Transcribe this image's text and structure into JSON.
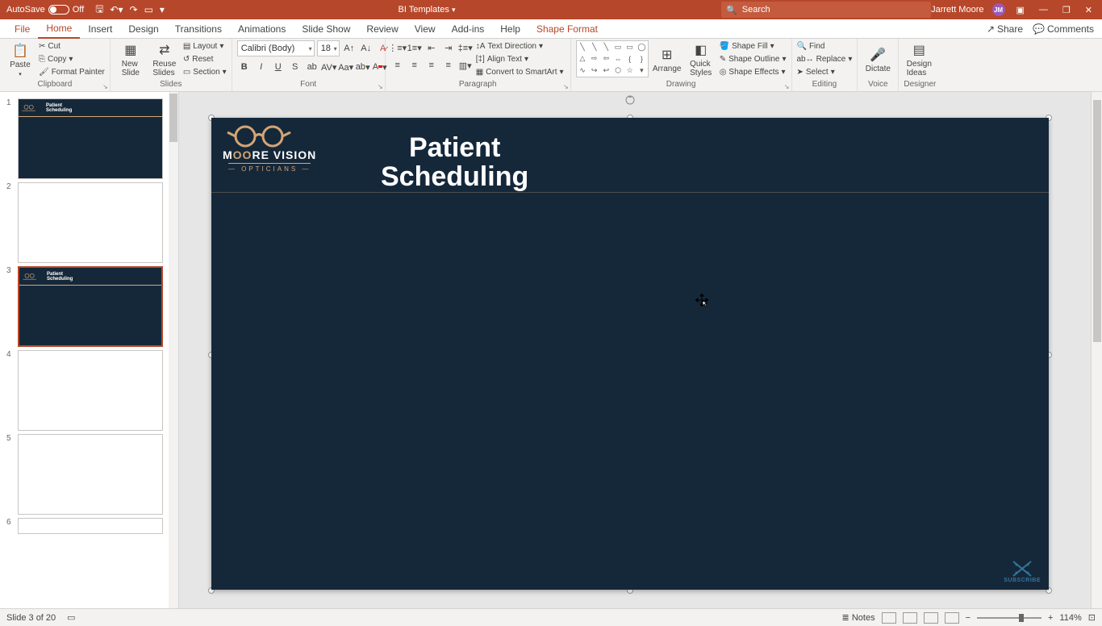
{
  "titlebar": {
    "autosave_label": "AutoSave",
    "autosave_state": "Off",
    "doc_title": "BI Templates",
    "search_placeholder": "Search",
    "user_name": "Jarrett Moore",
    "user_initials": "JM"
  },
  "tabs": {
    "file": "File",
    "home": "Home",
    "insert": "Insert",
    "design": "Design",
    "transitions": "Transitions",
    "animations": "Animations",
    "slideshow": "Slide Show",
    "review": "Review",
    "view": "View",
    "addins": "Add-ins",
    "help": "Help",
    "shapeformat": "Shape Format",
    "share": "Share",
    "comments": "Comments"
  },
  "ribbon": {
    "clipboard": {
      "label": "Clipboard",
      "paste": "Paste",
      "cut": "Cut",
      "copy": "Copy",
      "format_painter": "Format Painter"
    },
    "slides": {
      "label": "Slides",
      "new_slide": "New\nSlide",
      "reuse": "Reuse\nSlides",
      "layout": "Layout",
      "reset": "Reset",
      "section": "Section"
    },
    "font": {
      "label": "Font",
      "family": "Calibri (Body)",
      "size": "18"
    },
    "paragraph": {
      "label": "Paragraph",
      "text_direction": "Text Direction",
      "align_text": "Align Text",
      "smartart": "Convert to SmartArt"
    },
    "drawing": {
      "label": "Drawing",
      "arrange": "Arrange",
      "quick_styles": "Quick\nStyles",
      "shape_fill": "Shape Fill",
      "shape_outline": "Shape Outline",
      "shape_effects": "Shape Effects"
    },
    "editing": {
      "label": "Editing",
      "find": "Find",
      "replace": "Replace",
      "select": "Select"
    },
    "voice": {
      "label": "Voice",
      "dictate": "Dictate"
    },
    "designer": {
      "label": "Designer",
      "ideas": "Design\nIdeas"
    }
  },
  "thumbnails": {
    "numbers": [
      "1",
      "2",
      "3",
      "4",
      "5",
      "6"
    ],
    "mini_title_l1": "Patient",
    "mini_title_l2": "Scheduling"
  },
  "slide": {
    "logo_line1": "MOORE VISION",
    "logo_line2": "— OPTICIANS —",
    "title_l1": "Patient",
    "title_l2": "Scheduling",
    "subscribe": "SUBSCRIBE"
  },
  "status": {
    "slide_of": "Slide 3 of 20",
    "notes": "Notes",
    "zoom": "114%"
  }
}
